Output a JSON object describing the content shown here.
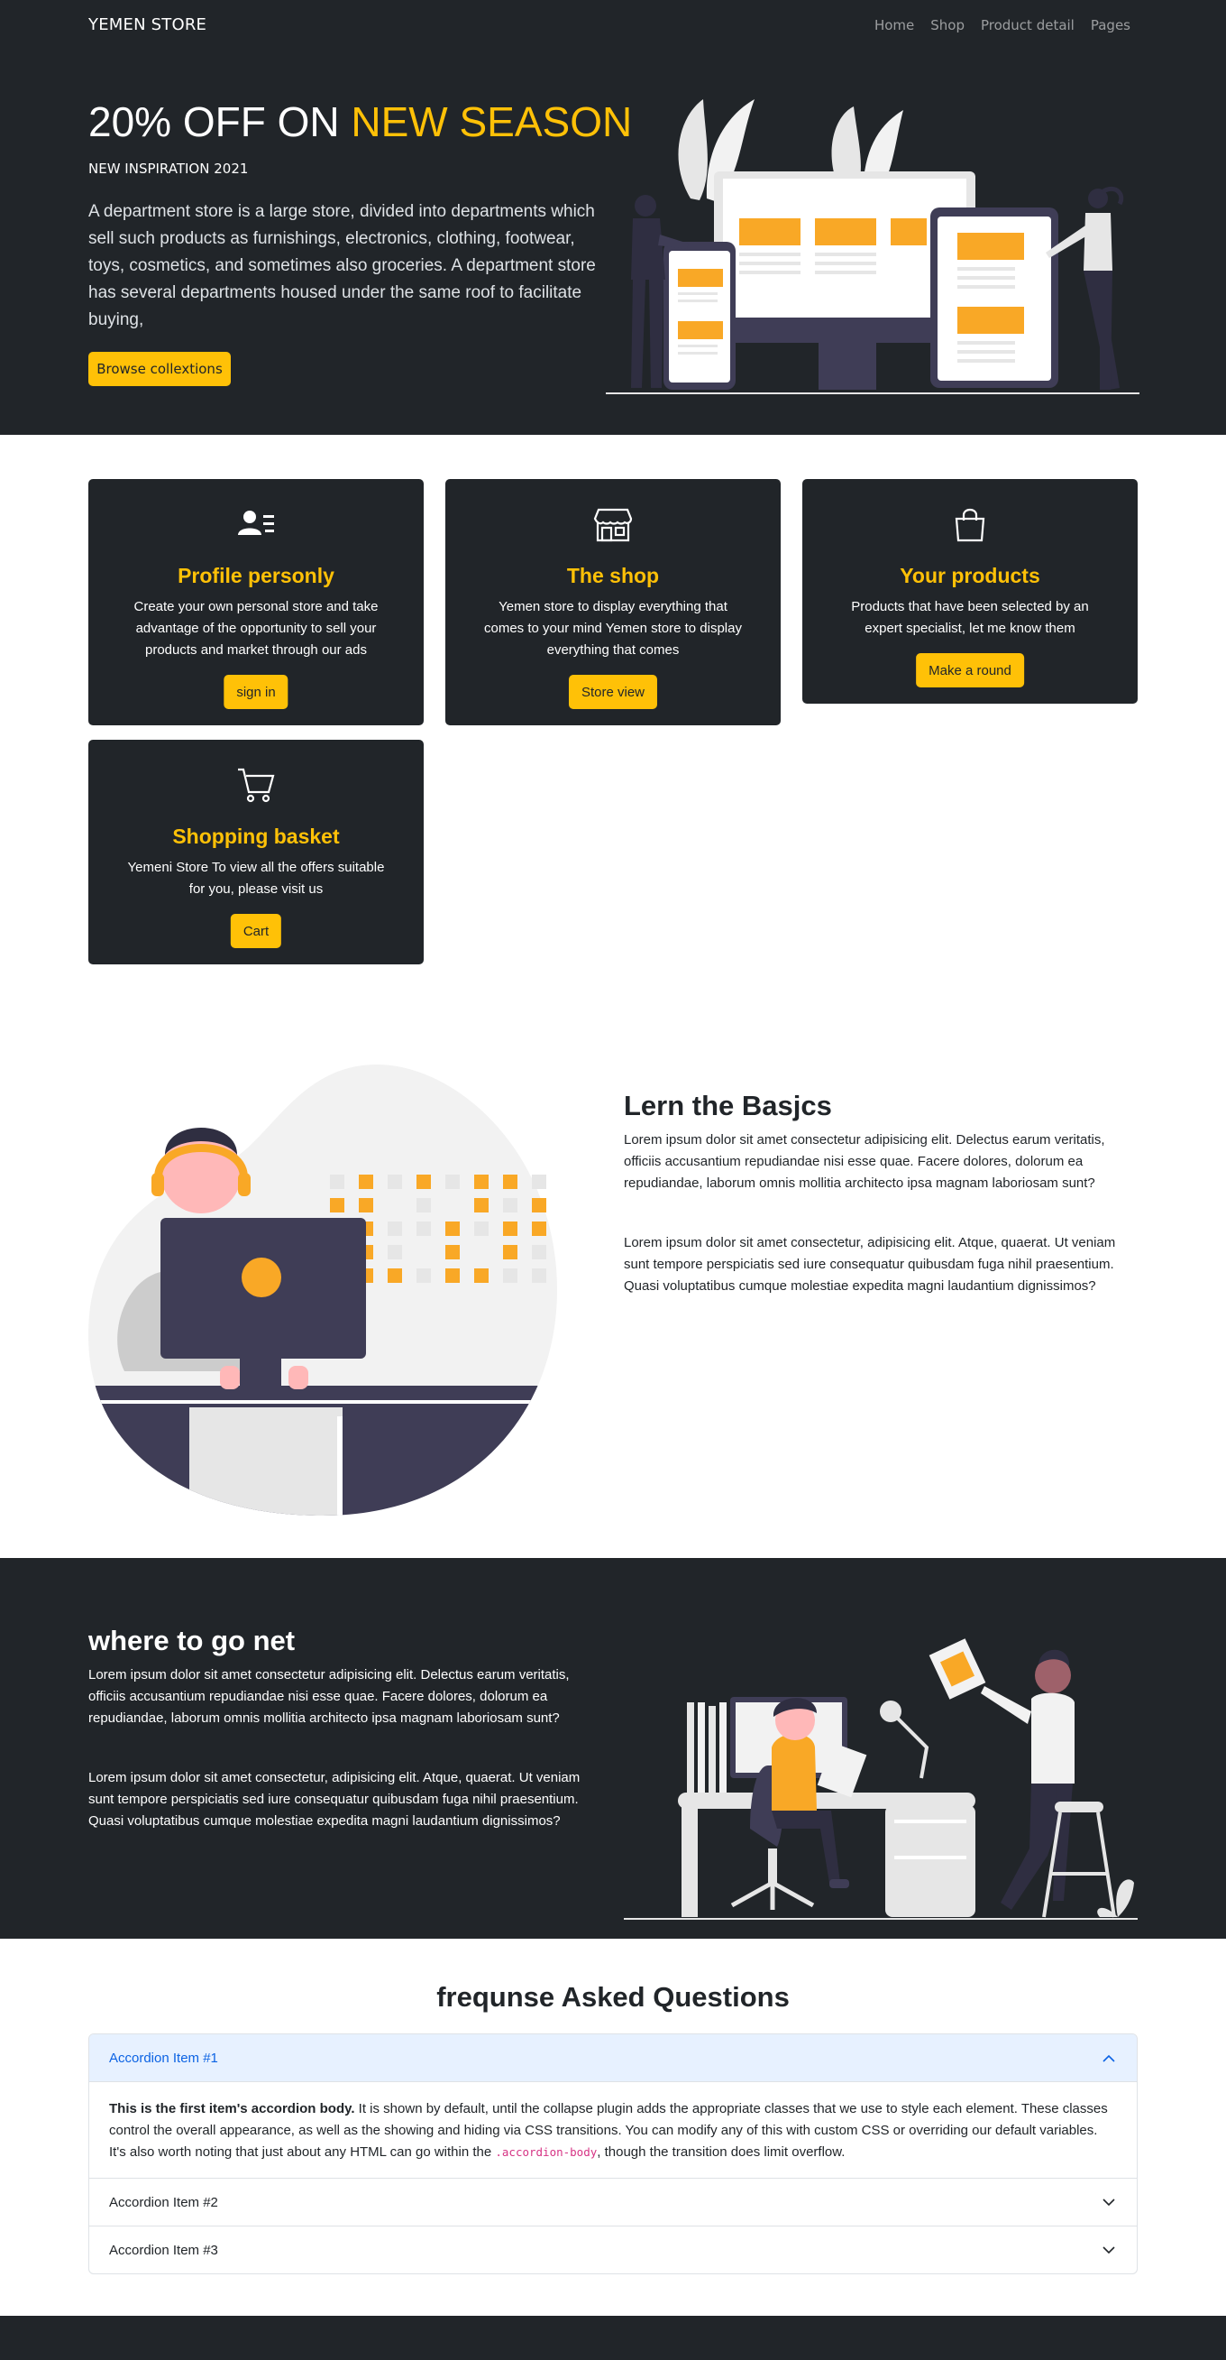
{
  "navbar": {
    "brand": "YEMEN STORE",
    "links": [
      "Home",
      "Shop",
      "Product detail",
      "Pages"
    ]
  },
  "hero": {
    "title_prefix": "20% OFF ON",
    "title_highlight": "NEW SEASON",
    "subtitle": "NEW INSPIRATION 2021",
    "description": "A department store is a large store, divided into departments which sell such products as furnishings, electronics, clothing, footwear, toys, cosmetics, and sometimes also groceries. A department store has several departments housed under the same roof to facilitate buying,",
    "button": "Browse collextions"
  },
  "cards": [
    {
      "icon": "user-list-icon",
      "title": "Profile personly",
      "text": "Create your own personal store and take advantage of the opportunity to sell your products and market through our ads",
      "button": "sign in"
    },
    {
      "icon": "shop-icon",
      "title": "The shop",
      "text": "Yemen store to display everything that comes to your mind Yemen store to display everything that comes",
      "button": "Store view"
    },
    {
      "icon": "bag-icon",
      "title": "Your products",
      "text": "Products that have been selected by an expert specialist, let me know them",
      "button": "Make a round"
    },
    {
      "icon": "cart-icon",
      "title": "Shopping basket",
      "text": "Yemeni Store To view all the offers suitable for you, please visit us",
      "button": "Cart"
    }
  ],
  "learn": {
    "title": "Lern the Basjcs",
    "paragraph1": "Lorem ipsum dolor sit amet consectetur adipisicing elit. Delectus earum veritatis, officiis accusantium repudiandae nisi esse quae. Facere dolores, dolorum ea repudiandae, laborum omnis mollitia architecto ipsa magnam laboriosam sunt?",
    "paragraph2": "Lorem ipsum dolor sit amet consectetur, adipisicing elit. Atque, quaerat. Ut veniam sunt tempore perspiciatis sed iure consequatur quibusdam fuga nihil praesentium. Quasi voluptatibus cumque molestiae expedita magni laudantium dignissimos?"
  },
  "where": {
    "title": "where to go net",
    "paragraph1": "Lorem ipsum dolor sit amet consectetur adipisicing elit. Delectus earum veritatis, officiis accusantium repudiandae nisi esse quae. Facere dolores, dolorum ea repudiandae, laborum omnis mollitia architecto ipsa magnam laboriosam sunt?",
    "paragraph2": "Lorem ipsum dolor sit amet consectetur, adipisicing elit. Atque, quaerat. Ut veniam sunt tempore perspiciatis sed iure consequatur quibusdam fuga nihil praesentium. Quasi voluptatibus cumque molestiae expedita magni laudantium dignissimos?"
  },
  "faq": {
    "title": "frequnse Asked Questions",
    "items": [
      {
        "label": "Accordion Item #1",
        "expanded": true
      },
      {
        "label": "Accordion Item #2",
        "expanded": false
      },
      {
        "label": "Accordion Item #3",
        "expanded": false
      }
    ],
    "body_strong": "This is the first item's accordion body.",
    "body_text1": " It is shown by default, until the collapse plugin adds the appropriate classes that we use to style each element. These classes control the overall appearance, as well as the showing and hiding via CSS transitions. You can modify any of this with custom CSS or overriding our default variables. It's also worth noting that just about any HTML can go within the ",
    "body_code": ".accordion-body",
    "body_text2": ", though the transition does limit overflow."
  },
  "colors": {
    "dark": "#212529",
    "accent": "#ffc107",
    "illustration_yellow": "#f9a826",
    "illustration_navy": "#3f3d56"
  }
}
